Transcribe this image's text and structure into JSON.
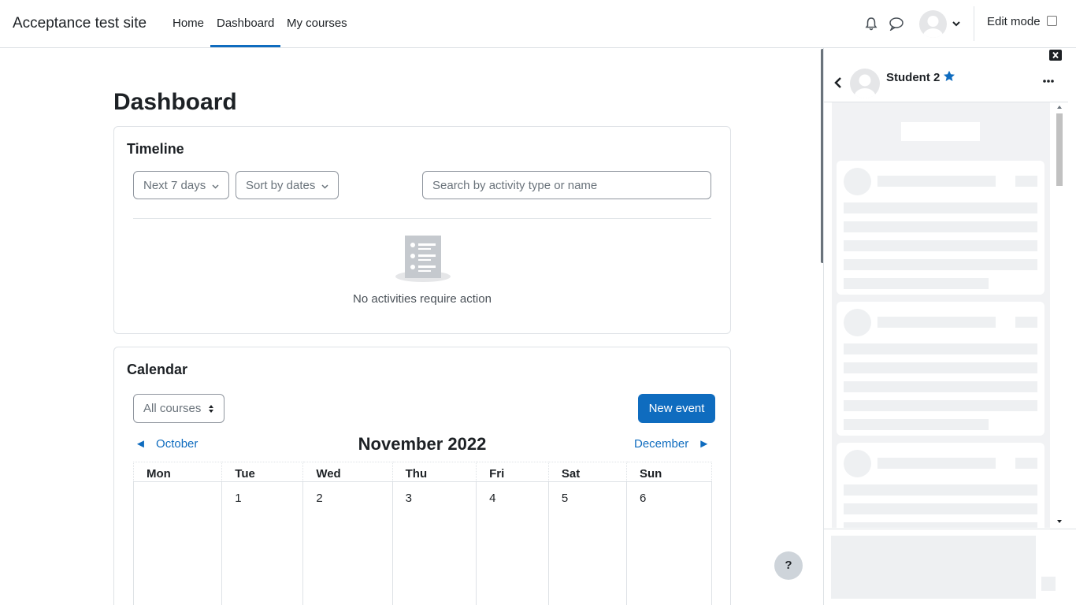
{
  "site": {
    "name": "Acceptance test site"
  },
  "nav": {
    "items": [
      {
        "label": "Home"
      },
      {
        "label": "Dashboard",
        "active": true
      },
      {
        "label": "My courses"
      }
    ],
    "edit_mode_label": "Edit mode",
    "edit_mode_checked": false,
    "icons": [
      "bell-icon",
      "chat-icon",
      "avatar",
      "chevron-down-icon"
    ]
  },
  "page": {
    "title": "Dashboard"
  },
  "timeline": {
    "title": "Timeline",
    "filter_label": "Next 7 days",
    "sort_label": "Sort by dates",
    "search_placeholder": "Search by activity type or name",
    "empty_text": "No activities require action"
  },
  "calendar": {
    "title": "Calendar",
    "course_filter": "All courses",
    "new_event_label": "New event",
    "prev_month": "October",
    "next_month": "December",
    "prev_arrow": "◄",
    "next_arrow": "►",
    "month_title": "November 2022",
    "weekdays": [
      "Mon",
      "Tue",
      "Wed",
      "Thu",
      "Fri",
      "Sat",
      "Sun"
    ],
    "week1": [
      "",
      "1",
      "2",
      "3",
      "4",
      "5",
      "6"
    ]
  },
  "help": {
    "label": "?"
  },
  "drawer": {
    "contact_name": "Student 2",
    "starred": true,
    "accent": "#0f6cbf"
  }
}
